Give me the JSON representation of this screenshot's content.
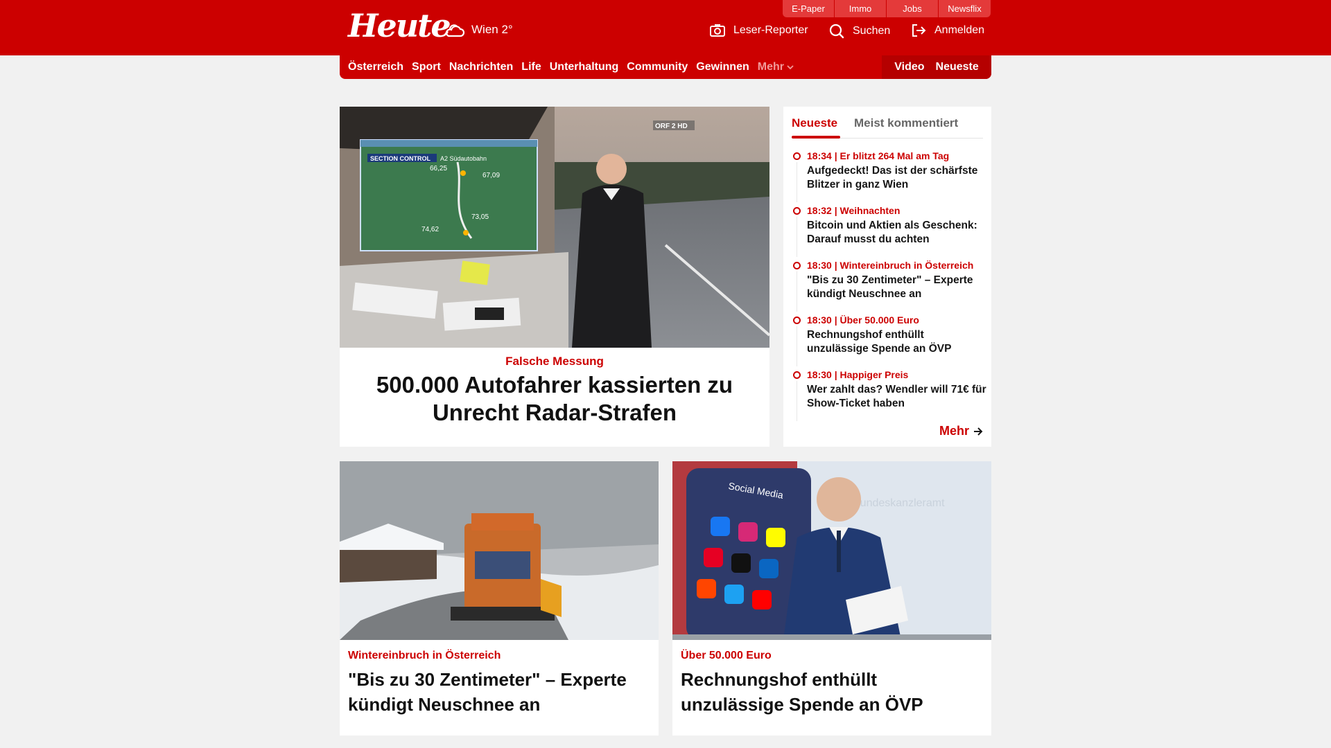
{
  "brand": {
    "logo": "Heute",
    "weather": "Wien 2°",
    "accent": "#cc0000"
  },
  "toplinks": [
    "E-Paper",
    "Immo",
    "Jobs",
    "Newsflix"
  ],
  "actions": {
    "reporter": "Leser-Reporter",
    "search": "Suchen",
    "login": "Anmelden"
  },
  "nav": {
    "items": [
      "Österreich",
      "Sport",
      "Nachrichten",
      "Life",
      "Unterhaltung",
      "Community",
      "Gewinnen"
    ],
    "more": "Mehr",
    "video": "Video",
    "latest": "Neueste"
  },
  "hero": {
    "kicker": "Falsche Messung",
    "title": "500.000 Autofahrer kassierten zu Unrecht Radar-Strafen",
    "image_text": {
      "section": "SECTION CONTROL",
      "road": "A2 Südautobahn",
      "km1": "66,25",
      "km2": "67,09",
      "km3": "73,05",
      "km4": "74,62",
      "channel": "ORF 2 HD"
    }
  },
  "sidebar": {
    "tabs": {
      "active": "Neueste",
      "other": "Meist kommentiert"
    },
    "items": [
      {
        "meta": "18:34 | Er blitzt 264 Mal am Tag",
        "title": "Aufgedeckt! Das ist der schärfste Blitzer in ganz Wien"
      },
      {
        "meta": "18:32 | Weihnachten",
        "title": "Bitcoin und Aktien als Geschenk: Darauf musst du achten"
      },
      {
        "meta": "18:30 | Wintereinbruch in Österreich",
        "title": "\"Bis zu 30 Zentimeter\" – Experte kündigt Neuschnee an"
      },
      {
        "meta": "18:30 | Über 50.000 Euro",
        "title": "Rechnungshof enthüllt unzulässige Spende an ÖVP"
      },
      {
        "meta": "18:30 | Happiger Preis",
        "title": "Wer zahlt das? Wendler will 71€ für Show-Ticket haben"
      }
    ],
    "more": "Mehr"
  },
  "cards": [
    {
      "kicker": "Wintereinbruch in Österreich",
      "title": "\"Bis zu 30 Zentimeter\" – Experte kündigt Neuschnee an"
    },
    {
      "kicker": "Über 50.000 Euro",
      "title": "Rechnungshof enthüllt unzulässige Spende an ÖVP",
      "image_text": {
        "header": "Social Media",
        "bg": "Bundeskanzleramt",
        "apps": [
          "Facebook",
          "Instagram",
          "Snapchat",
          "Pinterest",
          "TikTok",
          "LinkedIn",
          "Reddit",
          "Twitter",
          "YouTube"
        ]
      }
    }
  ]
}
